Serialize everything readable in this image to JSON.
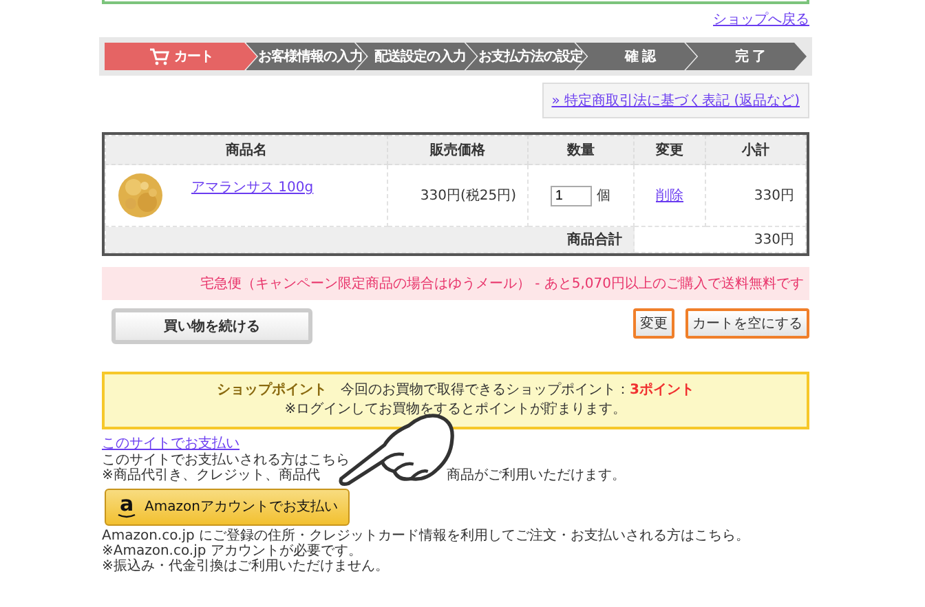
{
  "back_link": "ショップへ戻る",
  "steps": [
    {
      "label": "カート",
      "selected": true
    },
    {
      "label": "お客様情報の入力",
      "selected": false
    },
    {
      "label": "配送設定の入力",
      "selected": false
    },
    {
      "label": "お支払方法の設定",
      "selected": false
    },
    {
      "label": "確 認",
      "selected": false
    },
    {
      "label": "完 了",
      "selected": false
    }
  ],
  "legal_link": "» 特定商取引法に基づく表記 (返品など)",
  "cart_table": {
    "columns": [
      "商品名",
      "販売価格",
      "数量",
      "変更",
      "小計"
    ],
    "rows": [
      {
        "name": "アマランサス 100g",
        "price": "330円(税25円)",
        "quantity": "1",
        "unit": "個",
        "action": "削除",
        "subtotal": "330円"
      }
    ],
    "total_label": "商品合計",
    "total": "330円"
  },
  "shipping_notice": "宅急便（キャンペーン限定商品の場合はゆうメール） - あと5,070円以上のご購入で送料無料です",
  "continue_button": "買い物を続ける",
  "buttons": [
    "変更",
    "カートを空にする"
  ],
  "points": {
    "title": "ショップポイント",
    "text": "今回のお買物で取得できるショップポイント：",
    "value": "3ポイント",
    "note": "※ログインしてお買物をするとポイントが貯まります。"
  },
  "site_payment": {
    "link": "このサイトでお支払い",
    "text": "このサイトでお支払いされる方はこちら",
    "note_parts": [
      "※商品代引き、クレジット、商品代",
      "商品がご利用いただけます。"
    ]
  },
  "amazon": {
    "logo": "a",
    "button": "Amazonアカウントでお支払い",
    "lines": [
      "Amazon.co.jp にご登録の住所・クレジットカード情報を利用してご注文・お支払いされる方はこちら。",
      "※Amazon.co.jp アカウントが必要です。",
      "※振込み・代金引換はご利用いただけません。"
    ]
  }
}
